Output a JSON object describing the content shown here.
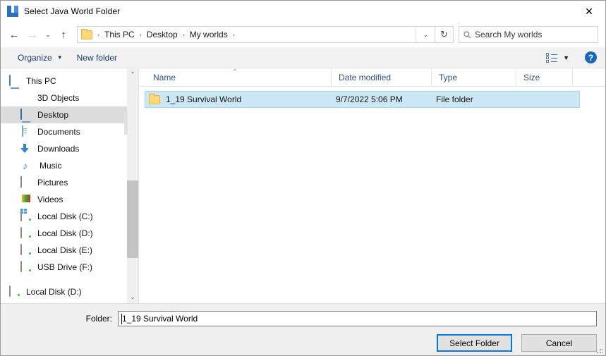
{
  "window": {
    "title": "Select Java World Folder",
    "app_icon": "java-launcher-icon",
    "close_label": "✕"
  },
  "nav": {
    "back_icon": "←",
    "forward_icon": "→",
    "recent_icon": "⌄",
    "up_icon": "↑",
    "refresh_icon": "↻",
    "dropdown_icon": "⌄",
    "breadcrumb": [
      {
        "label": "This PC"
      },
      {
        "label": "Desktop"
      },
      {
        "label": "My worlds"
      }
    ],
    "separator": "›"
  },
  "search": {
    "placeholder": "Search My worlds",
    "icon": "search-icon"
  },
  "commandbar": {
    "organize_label": "Organize",
    "organize_caret": "▼",
    "new_folder_label": "New folder",
    "view_caret": "▼",
    "help_label": "?"
  },
  "sidebar": {
    "items": [
      {
        "label": "This PC",
        "icon": "pc-icon",
        "indent": false,
        "selected": false
      },
      {
        "label": "3D Objects",
        "icon": "cube-icon",
        "indent": true,
        "selected": false
      },
      {
        "label": "Desktop",
        "icon": "desktop-icon",
        "indent": true,
        "selected": true
      },
      {
        "label": "Documents",
        "icon": "documents-icon",
        "indent": true,
        "selected": false
      },
      {
        "label": "Downloads",
        "icon": "downloads-icon",
        "indent": true,
        "selected": false
      },
      {
        "label": "Music",
        "icon": "music-icon",
        "indent": true,
        "selected": false
      },
      {
        "label": "Pictures",
        "icon": "pictures-icon",
        "indent": true,
        "selected": false
      },
      {
        "label": "Videos",
        "icon": "videos-icon",
        "indent": true,
        "selected": false
      },
      {
        "label": "Local Disk (C:)",
        "icon": "drive-c-icon",
        "indent": true,
        "selected": false
      },
      {
        "label": "Local Disk (D:)",
        "icon": "drive-icon",
        "indent": true,
        "selected": false
      },
      {
        "label": "Local Disk (E:)",
        "icon": "drive-icon",
        "indent": true,
        "selected": false
      },
      {
        "label": "USB Drive (F:)",
        "icon": "drive-icon",
        "indent": true,
        "selected": false
      },
      {
        "label": "Local Disk (D:)",
        "icon": "drive-icon",
        "indent": false,
        "selected": false
      }
    ],
    "scroll_up_icon": "⌃",
    "scroll_down_icon": "⌄"
  },
  "filelist": {
    "columns": [
      {
        "key": "name",
        "label": "Name",
        "sorted": "asc",
        "sort_icon": "⌃"
      },
      {
        "key": "date",
        "label": "Date modified"
      },
      {
        "key": "type",
        "label": "Type"
      },
      {
        "key": "size",
        "label": "Size"
      }
    ],
    "rows": [
      {
        "icon": "folder-icon",
        "name": "1_19 Survival World",
        "date": "9/7/2022 5:06 PM",
        "type": "File folder",
        "size": "",
        "selected": true
      }
    ]
  },
  "footer": {
    "folder_label": "Folder:",
    "folder_value": "1_19 Survival World",
    "select_button": "Select Folder",
    "cancel_button": "Cancel"
  },
  "colors": {
    "accent": "#0078d7",
    "selection": "#cce8f7",
    "selection_border": "#a9d5ef",
    "chrome": "#f0f0f0",
    "link_text": "#1b3c6b",
    "column_header_text": "#34517a"
  }
}
